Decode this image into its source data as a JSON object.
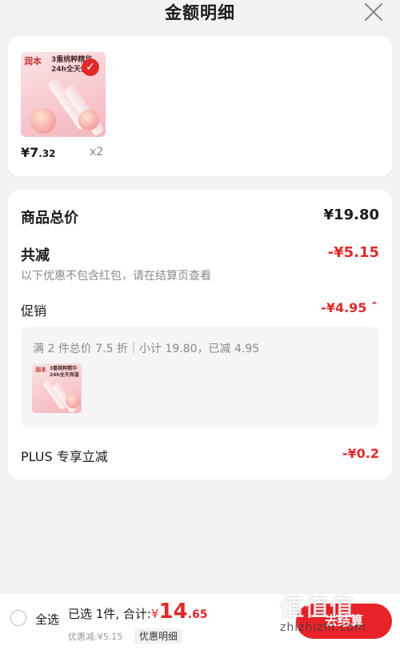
{
  "header": {
    "title": "金额明细"
  },
  "product": {
    "brand": "润本",
    "promo": "3重桃粹精华 24h全天保湿",
    "price_int": "¥7",
    "price_dec": ".32",
    "qty": "x2"
  },
  "summary": {
    "total_label": "商品总价",
    "total_value": "¥19.80",
    "reduce_label": "共减",
    "reduce_value": "-¥5.15",
    "note": "以下优惠不包含红包，请在结算页查看",
    "promo_label": "促销",
    "promo_value": "-¥4.95 ˆ",
    "promo_detail": "满 2 件总价 7.5 折｜小计 19.80，已减 4.95",
    "plus_label": "PLUS 专享立减",
    "plus_value": "-¥0.2"
  },
  "bottom": {
    "select_all": "全选",
    "selected_prefix": "已选 1件, 合计:",
    "total_currency": "¥",
    "total_int": "14",
    "total_dec": ".65",
    "discount": "优惠减:¥5.15",
    "detail": "优惠明细",
    "checkout": "去结算"
  },
  "watermark": {
    "text": "值值值",
    "url": "zhizhizhi.com"
  }
}
